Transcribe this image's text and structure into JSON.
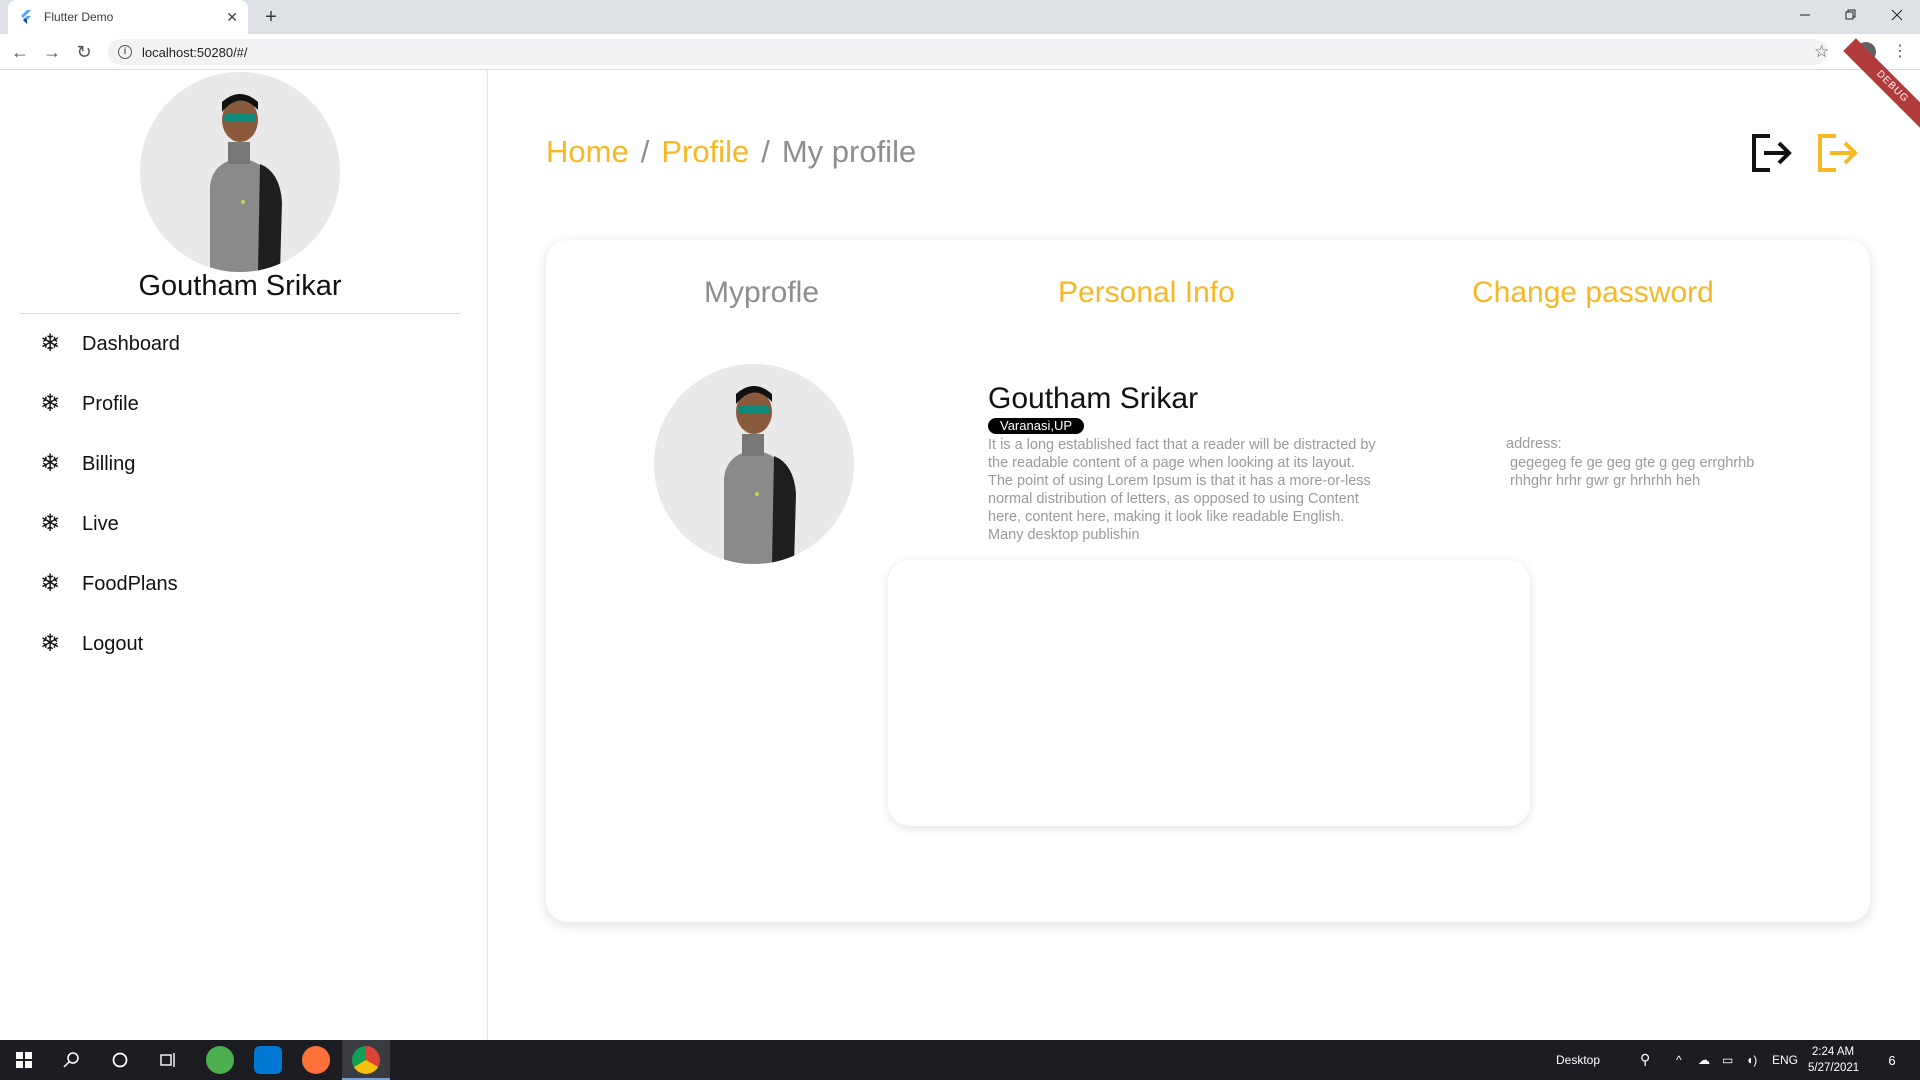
{
  "browser": {
    "tab_title": "Flutter Demo",
    "url": "localhost:50280/#/",
    "new_tab_symbol": "+",
    "close_symbol": "✕"
  },
  "sidebar": {
    "user_name": "Goutham Srikar",
    "items": [
      {
        "label": "Dashboard",
        "icon": "snowflake-icon"
      },
      {
        "label": "Profile",
        "icon": "snowflake-icon"
      },
      {
        "label": "Billing",
        "icon": "snowflake-icon"
      },
      {
        "label": "Live",
        "icon": "snowflake-icon"
      },
      {
        "label": "FoodPlans",
        "icon": "snowflake-icon"
      },
      {
        "label": "Logout",
        "icon": "snowflake-icon"
      }
    ]
  },
  "breadcrumb": {
    "home": "Home",
    "sep": "/",
    "profile": "Profile",
    "current": "My profile"
  },
  "debug_banner": "DEBUG",
  "card": {
    "tabs": {
      "myprofile": "Myprofle",
      "personal_info": "Personal Info",
      "change_password": "Change password"
    },
    "profile": {
      "name": "Goutham Srikar",
      "location": "Varanasi,UP",
      "bio": "It is a long established fact that a reader will be distracted by the readable content of a page when looking at its layout. The point of using Lorem Ipsum is that it has a more-or-less normal distribution of letters, as opposed to using Content here, content here, making it look like readable English. Many desktop publishin",
      "address_label": "address:",
      "address_value": "gegegeg fe ge geg  gte g geg errghrhb rhhghr hrhr gwr gr hrhrhh heh"
    }
  },
  "taskbar": {
    "desktop_label": "Desktop",
    "lang": "ENG",
    "time": "2:24 AM",
    "date": "5/27/2021",
    "notification_count": "6"
  },
  "colors": {
    "accent": "#f7b824",
    "muted": "#8e8e8e",
    "debug": "#b13b3b"
  }
}
